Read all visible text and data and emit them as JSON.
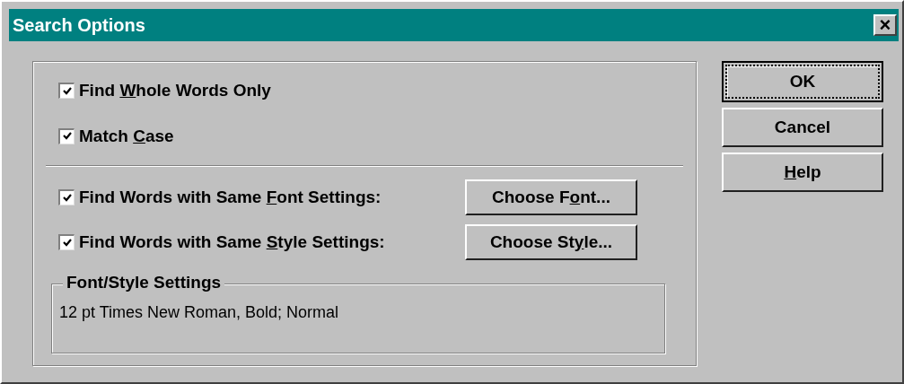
{
  "window": {
    "title": "Search Options",
    "close_icon": "×"
  },
  "options": [
    {
      "label": [
        "Find ",
        "W",
        "hole Words Only"
      ],
      "checked": true,
      "kind": "plain"
    },
    {
      "label": [
        "Match ",
        "C",
        "ase"
      ],
      "checked": true,
      "kind": "plain"
    },
    {
      "label": [
        "Find Words with Same ",
        "F",
        "ont Settings:"
      ],
      "checked": true,
      "kind": "with_button",
      "button": [
        "Choose F",
        "o",
        "nt..."
      ]
    },
    {
      "label": [
        "Find Words with Same ",
        "S",
        "tyle Settings:"
      ],
      "checked": true,
      "kind": "with_button",
      "button": [
        "Choose St",
        "y",
        "le..."
      ]
    }
  ],
  "settings_group": {
    "title": "Font/Style Settings",
    "value": "12 pt Times New Roman, Bold; Normal"
  },
  "buttons": [
    {
      "label": [
        "OK"
      ],
      "default": true
    },
    {
      "label": [
        "Cancel"
      ],
      "default": false
    },
    {
      "label": [
        "H",
        "elp"
      ],
      "underline_first": true,
      "default": false
    }
  ]
}
